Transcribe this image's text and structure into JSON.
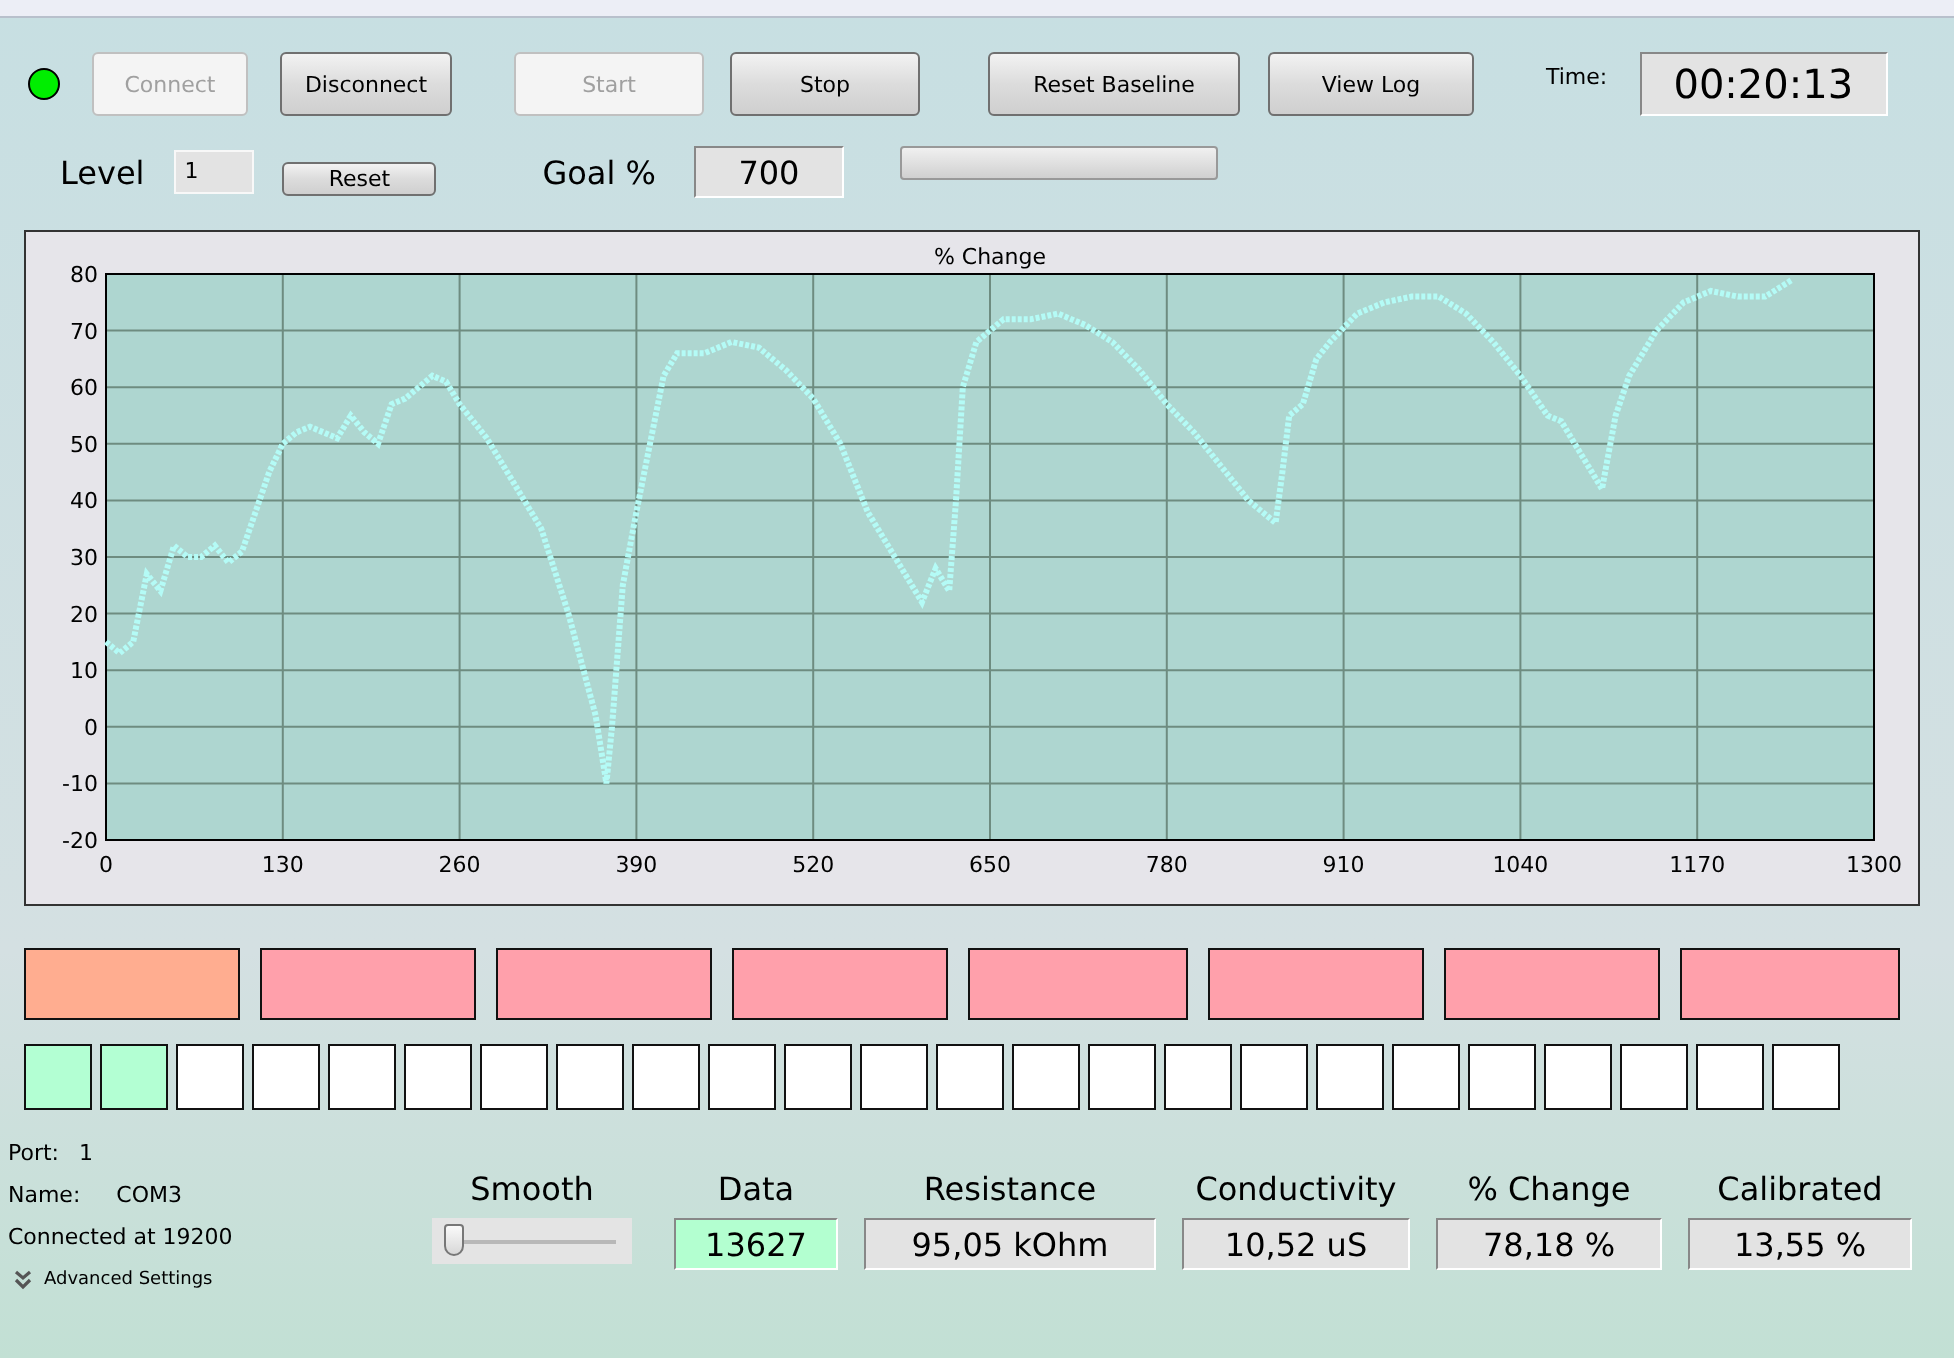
{
  "status_light": {
    "color": "#00ee00"
  },
  "buttons": [
    {
      "label": "Connect",
      "disabled": true
    },
    {
      "label": "Disconnect",
      "disabled": false
    },
    {
      "label": "Start",
      "disabled": true
    },
    {
      "label": "Stop",
      "disabled": false
    },
    {
      "label": "Reset Baseline",
      "disabled": false
    },
    {
      "label": "View Log",
      "disabled": false
    }
  ],
  "time": {
    "label": "Time:",
    "value": "00:20:13"
  },
  "level": {
    "label": "Level",
    "value": "1",
    "reset": "Reset"
  },
  "goal": {
    "label": "Goal %",
    "value": "700",
    "progress": {
      "level": 0
    }
  },
  "chart": {
    "chart_data": {
      "type": "line",
      "title": "% Change",
      "x": [
        0,
        10,
        20,
        30,
        40,
        50,
        60,
        70,
        80,
        90,
        100,
        110,
        120,
        130,
        140,
        150,
        160,
        170,
        180,
        190,
        200,
        210,
        220,
        230,
        240,
        250,
        260,
        280,
        300,
        320,
        340,
        360,
        368,
        372,
        380,
        390,
        400,
        410,
        420,
        440,
        460,
        480,
        500,
        520,
        540,
        560,
        580,
        600,
        610,
        620,
        625,
        630,
        640,
        660,
        680,
        700,
        720,
        740,
        760,
        780,
        800,
        820,
        840,
        860,
        865,
        870,
        880,
        890,
        900,
        920,
        940,
        960,
        980,
        1000,
        1020,
        1040,
        1060,
        1070,
        1080,
        1100,
        1110,
        1120,
        1140,
        1160,
        1180,
        1200,
        1220,
        1240
      ],
      "grid": true,
      "series": [
        {
          "color": "#b4fbf6",
          "line_style": "dotted",
          "values": [
            15,
            13,
            15,
            27,
            24,
            32,
            30,
            30,
            32,
            29,
            31,
            38,
            45,
            50,
            52,
            53,
            52,
            51,
            55,
            52,
            50,
            57,
            58,
            60,
            62,
            61,
            57,
            51,
            43,
            35,
            20,
            2,
            -10,
            0,
            25,
            38,
            50,
            62,
            66,
            66,
            68,
            67,
            63,
            58,
            50,
            38,
            30,
            22,
            28,
            24,
            40,
            60,
            68,
            72,
            72,
            73,
            71,
            68,
            63,
            57,
            52,
            46,
            40,
            36,
            45,
            55,
            57,
            65,
            68,
            73,
            75,
            76,
            76,
            73,
            68,
            62,
            55,
            54,
            50,
            42,
            55,
            62,
            70,
            75,
            77,
            76,
            76,
            79
          ]
        }
      ],
      "xlim": [
        0,
        1300
      ],
      "ylim": [
        -20,
        80
      ],
      "xticks": [
        0,
        130,
        260,
        390,
        520,
        650,
        780,
        910,
        1040,
        1170,
        1300
      ],
      "yticks": [
        -20,
        -10,
        0,
        10,
        20,
        30,
        40,
        50,
        60,
        70,
        80
      ]
    }
  },
  "blocks": [
    {
      "color": "#ffad90"
    },
    {
      "color": "#ffa0ab"
    },
    {
      "color": "#ffa0ab"
    },
    {
      "color": "#ffa0ab"
    },
    {
      "color": "#ffa0ab"
    },
    {
      "color": "#ffa0ab"
    },
    {
      "color": "#ffa0ab"
    },
    {
      "color": "#ffa0ab"
    }
  ],
  "squares": [
    {
      "color": "#b3ffd3"
    },
    {
      "color": "#b3ffd3"
    },
    {
      "color": "#ffffff"
    },
    {
      "color": "#ffffff"
    },
    {
      "color": "#ffffff"
    },
    {
      "color": "#ffffff"
    },
    {
      "color": "#ffffff"
    },
    {
      "color": "#ffffff"
    },
    {
      "color": "#ffffff"
    },
    {
      "color": "#ffffff"
    },
    {
      "color": "#ffffff"
    },
    {
      "color": "#ffffff"
    },
    {
      "color": "#ffffff"
    },
    {
      "color": "#ffffff"
    },
    {
      "color": "#ffffff"
    },
    {
      "color": "#ffffff"
    },
    {
      "color": "#ffffff"
    },
    {
      "color": "#ffffff"
    },
    {
      "color": "#ffffff"
    },
    {
      "color": "#ffffff"
    },
    {
      "color": "#ffffff"
    },
    {
      "color": "#ffffff"
    },
    {
      "color": "#ffffff"
    },
    {
      "color": "#ffffff"
    }
  ],
  "port": {
    "port_label": "Port:",
    "port_value": "1",
    "name_label": "Name:",
    "name_value": "COM3",
    "connection": "Connected at 19200",
    "advanced": "Advanced Settings"
  },
  "smooth": {
    "label": "Smooth",
    "level": 0
  },
  "readouts": [
    {
      "label": "Data",
      "value": "13627",
      "color": "#b3ffd0"
    },
    {
      "label": "Resistance",
      "value": "95,05 kOhm",
      "color": "#e3e3e3"
    },
    {
      "label": "Conductivity",
      "value": "10,52 uS",
      "color": "#e3e3e3"
    },
    {
      "label": "% Change",
      "value": "78,18 %",
      "color": "#e3e3e3"
    },
    {
      "label": "Calibrated",
      "value": "13,55 %",
      "color": "#e3e3e3"
    }
  ]
}
